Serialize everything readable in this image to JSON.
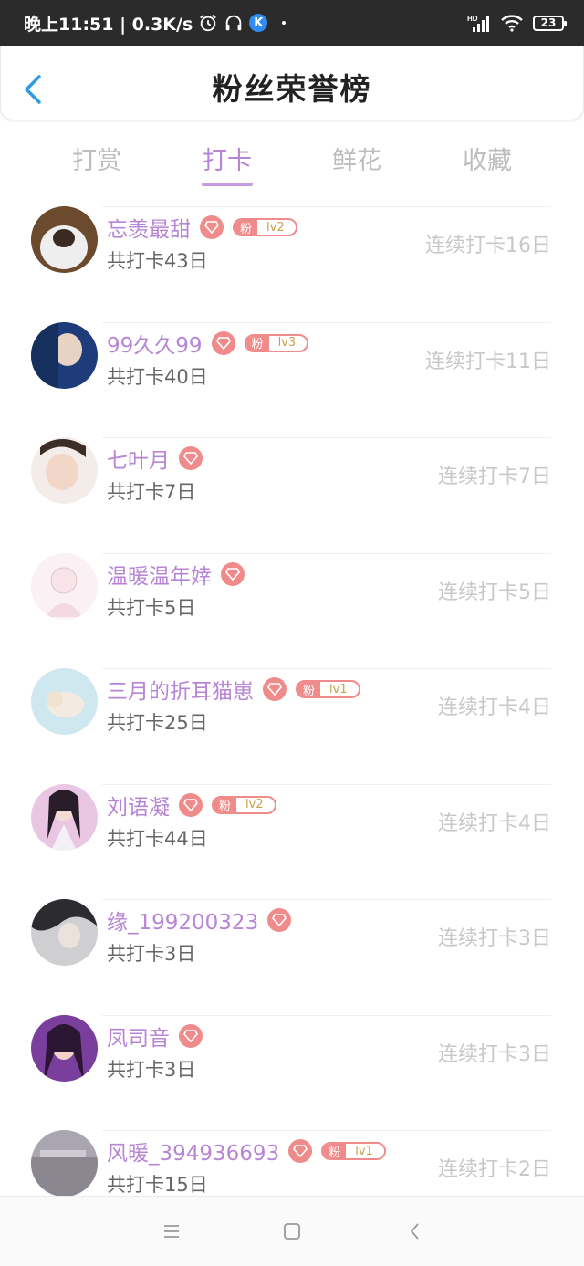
{
  "status_bar": {
    "time_speed": "晚上11:51 | 0.3K/s",
    "k_icon_label": "K",
    "network": "HD",
    "battery": "23"
  },
  "header": {
    "title": "粉丝荣誉榜"
  },
  "tabs": [
    {
      "label": "打赏",
      "active": false
    },
    {
      "label": "打卡",
      "active": true
    },
    {
      "label": "鲜花",
      "active": false
    },
    {
      "label": "收藏",
      "active": false
    }
  ],
  "colors": {
    "accent": "#b784d6",
    "badge": "#f08b8b",
    "level": "#c9a14a"
  },
  "badge_fan_label": "粉",
  "fans": [
    {
      "name": "忘羡最甜",
      "total": "共打卡43日",
      "streak": "连续打卡16日",
      "level": "lv2"
    },
    {
      "name": "99久久99",
      "total": "共打卡40日",
      "streak": "连续打卡11日",
      "level": "lv3"
    },
    {
      "name": "七叶月",
      "total": "共打卡7日",
      "streak": "连续打卡7日",
      "level": ""
    },
    {
      "name": "温暖温年婞",
      "total": "共打卡5日",
      "streak": "连续打卡5日",
      "level": ""
    },
    {
      "name": "三月的折耳猫崽",
      "total": "共打卡25日",
      "streak": "连续打卡4日",
      "level": "lv1"
    },
    {
      "name": "刘语凝",
      "total": "共打卡44日",
      "streak": "连续打卡4日",
      "level": "lv2"
    },
    {
      "name": "缘_199200323",
      "total": "共打卡3日",
      "streak": "连续打卡3日",
      "level": ""
    },
    {
      "name": "凤司音",
      "total": "共打卡3日",
      "streak": "连续打卡3日",
      "level": ""
    },
    {
      "name": "风暖_394936693",
      "total": "共打卡15日",
      "streak": "连续打卡2日",
      "level": "lv1"
    }
  ]
}
